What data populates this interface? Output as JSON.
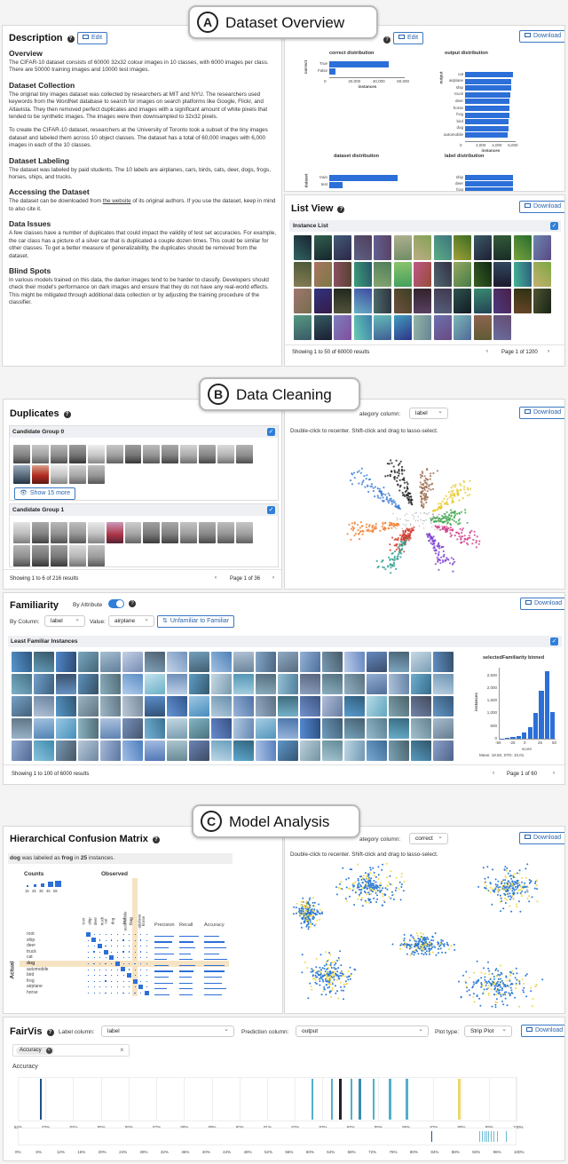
{
  "banners": {
    "a_letter": "A",
    "a_text": "Dataset Overview",
    "b_letter": "B",
    "b_text": "Data Cleaning",
    "c_letter": "C",
    "c_text": "Model Analysis"
  },
  "buttons": {
    "edit": "Edit",
    "download": "Download"
  },
  "description": {
    "title": "Description",
    "sections": [
      {
        "heading": "Overview",
        "body": "The CIFAR-10 dataset consists of 60000 32x32 colour images in 10 classes, with 6000 images per class. There are 50000 training images and 10000 test images."
      },
      {
        "heading": "Dataset Collection",
        "body": "The original tiny images dataset was collected by researchers at MIT and NYU. The researchers used keywords from the WordNet database to search for images on search platforms like Google, Flickr, and Altavista. They then removed perfect duplicates and images with a significant amount of white pixels that tended to be synthetic images. The images were then downsampled to 32x32 pixels.",
        "body2": "To create the CIFAR-10 dataset, researchers at the University of Toronto took a subset of the tiny images dataset and labeled them across 10 object classes. The dataset has a total of 60,000 images with 6,000 images in each of the 10 classes."
      },
      {
        "heading": "Dataset Labeling",
        "body": "The dataset was labeled by paid students. The 10 labels are airplanes, cars, birds, cats, deer, dogs, frogs, horses, ships, and trucks."
      },
      {
        "heading": "Accessing the Dataset",
        "body_pre": "The dataset can be downloaded from ",
        "link": "the website",
        "body_post": " of its original authors. If you use the dataset, keep in mind to also cite it."
      },
      {
        "heading": "Data Issues",
        "body": "A few classes have a number of duplicates that could impact the validity of test set accuracies. For example, the car class has a picture of a silver car that is duplicated a couple dozen times. This could be similar for other classes. To get a better measure of generalizability, the duplicates should be removed from the dataset."
      },
      {
        "heading": "Blind Spots",
        "body": "In various models trained on this data, the darker images tend to be harder to classify. Developers should check their model's performance on dark images and ensure that they do not have any real-world effects. This might be mitigated through additional data collection or by adjusting the training procedure of the classifier."
      }
    ]
  },
  "chart_data": [
    {
      "type": "bar",
      "title": "correct distribution",
      "ylabel": "correct",
      "xlabel": "instances",
      "categories": [
        "True",
        "False"
      ],
      "values": [
        49000,
        5000
      ],
      "xticks": [
        "0",
        "20,000",
        "40,000",
        "60,000"
      ],
      "xlim": [
        0,
        62000
      ]
    },
    {
      "type": "bar",
      "title": "output distribution",
      "ylabel": "output",
      "xlabel": "instances",
      "categories": [
        "cat",
        "airplane",
        "ship",
        "truck",
        "deer",
        "horse",
        "frog",
        "bird",
        "dog",
        "automobile"
      ],
      "values": [
        6000,
        5800,
        5700,
        5600,
        5500,
        5550,
        5500,
        5450,
        5400,
        5350
      ],
      "xticks": [
        "0",
        "2,000",
        "4,000",
        "6,000"
      ],
      "xlim": [
        0,
        6300
      ]
    },
    {
      "type": "bar",
      "title": "dataset distribution",
      "ylabel": "dataset",
      "xlabel": "instances",
      "categories": [
        "train",
        "test"
      ],
      "values": [
        50000,
        10000
      ],
      "xticks": [
        "0",
        "20,000",
        "40,000"
      ],
      "xlim": [
        0,
        55000
      ]
    },
    {
      "type": "bar",
      "title": "label distribution",
      "categories": [
        "ship",
        "deer",
        "frog",
        "cat"
      ],
      "values": [
        6000,
        6000,
        6000,
        6000
      ],
      "xlim": [
        0,
        6300
      ]
    },
    {
      "type": "bar",
      "title": "selectedFamiliarity binned",
      "ylabel": "instances",
      "xlabel": "score",
      "bins": [
        -50,
        -40,
        -30,
        -20,
        -10,
        0,
        10,
        20,
        30
      ],
      "values": [
        10,
        30,
        60,
        120,
        250,
        450,
        1000,
        1900,
        2650,
        1050
      ],
      "yticks": [
        "0",
        "500",
        "1,000",
        "1,500",
        "2,000",
        "2,500"
      ],
      "xticks": [
        "-50",
        "-25",
        "0",
        "25",
        "50"
      ],
      "ylim": [
        0,
        2800
      ]
    },
    {
      "type": "strip",
      "title": "Accuracy",
      "xticks": [
        "82%",
        "83%",
        "84%",
        "85%",
        "86%",
        "87%",
        "88%",
        "89%",
        "90%",
        "91%",
        "92%",
        "93%",
        "94%",
        "95%",
        "96%",
        "97%",
        "98%",
        "99%",
        "100%"
      ]
    }
  ],
  "listview": {
    "title": "List View",
    "subtitle": "Instance List",
    "status": "Showing 1 to 50 of 60000 results",
    "page": "Page 1 of 1200"
  },
  "duplicates": {
    "title": "Duplicates",
    "group0": "Candidate Group 0",
    "show_more": "Show 15 more",
    "group1": "Candidate Group 1",
    "status": "Showing 1 to 6 of 216 results",
    "page": "Page 1 of 36"
  },
  "embed_b": {
    "category_label": "ategory column:",
    "category_value": "label",
    "hint": "Double-click to recenter. Shift-click and drag to lasso-select."
  },
  "familiarity": {
    "title": "Familiarity",
    "by_attribute": "By Attribute",
    "by_column": "By Column:",
    "column_value": "label",
    "value_label": "Value:",
    "value_value": "airplane",
    "sort_button": "Unfamiliar to Familiar",
    "subtitle": "Least Familiar Instances",
    "stats": "Mean: 18.50, STD: 10.01",
    "status": "Showing 1 to 100 of 6000 results",
    "page": "Page 1 of 60"
  },
  "confusion": {
    "title": "Hierarchical Confusion Matrix",
    "caption_pre": "dog",
    "caption_mid": " was labeled as ",
    "caption_target": "frog",
    "caption_in": " in ",
    "caption_count": "25",
    "caption_post": " instances.",
    "counts": "Counts",
    "count_ticks": [
      "1k",
      "2k",
      "3k",
      "4k",
      "5k"
    ],
    "observed": "Observed",
    "actual": "Actual",
    "rows": [
      "root",
      "ship",
      "deer",
      "truck",
      "cat",
      "dog",
      "automobile",
      "bird",
      "frog",
      "airplane",
      "horse"
    ],
    "cols": [
      "root",
      "ship",
      "deer",
      "truck",
      "cat",
      "dog",
      "automobile",
      "bird",
      "frog",
      "airplane",
      "horse"
    ],
    "metric_headers": [
      "Precision",
      "Recall",
      "Accuracy"
    ]
  },
  "embed_c": {
    "category_label": "ategory column:",
    "category_value": "correct",
    "hint": "Double-click to recenter. Shift-click and drag to lasso-select."
  },
  "fairvis": {
    "title": "FairVis",
    "label_col": "Label column:",
    "label_value": "label",
    "pred_col": "Prediction column:",
    "pred_value": "output",
    "plot_type": "Plot type:",
    "plot_value": "Strip Plot",
    "chip": "Accuracy",
    "metric": "Accuracy",
    "bottom_ticks": [
      "0%",
      "6%",
      "12%",
      "16%",
      "20%",
      "24%",
      "28%",
      "32%",
      "36%",
      "40%",
      "44%",
      "48%",
      "52%",
      "56%",
      "60%",
      "64%",
      "68%",
      "72%",
      "76%",
      "80%",
      "84%",
      "88%",
      "92%",
      "96%",
      "100%"
    ]
  },
  "colors": {
    "accent": "#2f7fd8",
    "highlight": "#f6e3c3",
    "scatter_blue": "#2e7bd6",
    "scatter_yellow": "#f2d94a"
  }
}
